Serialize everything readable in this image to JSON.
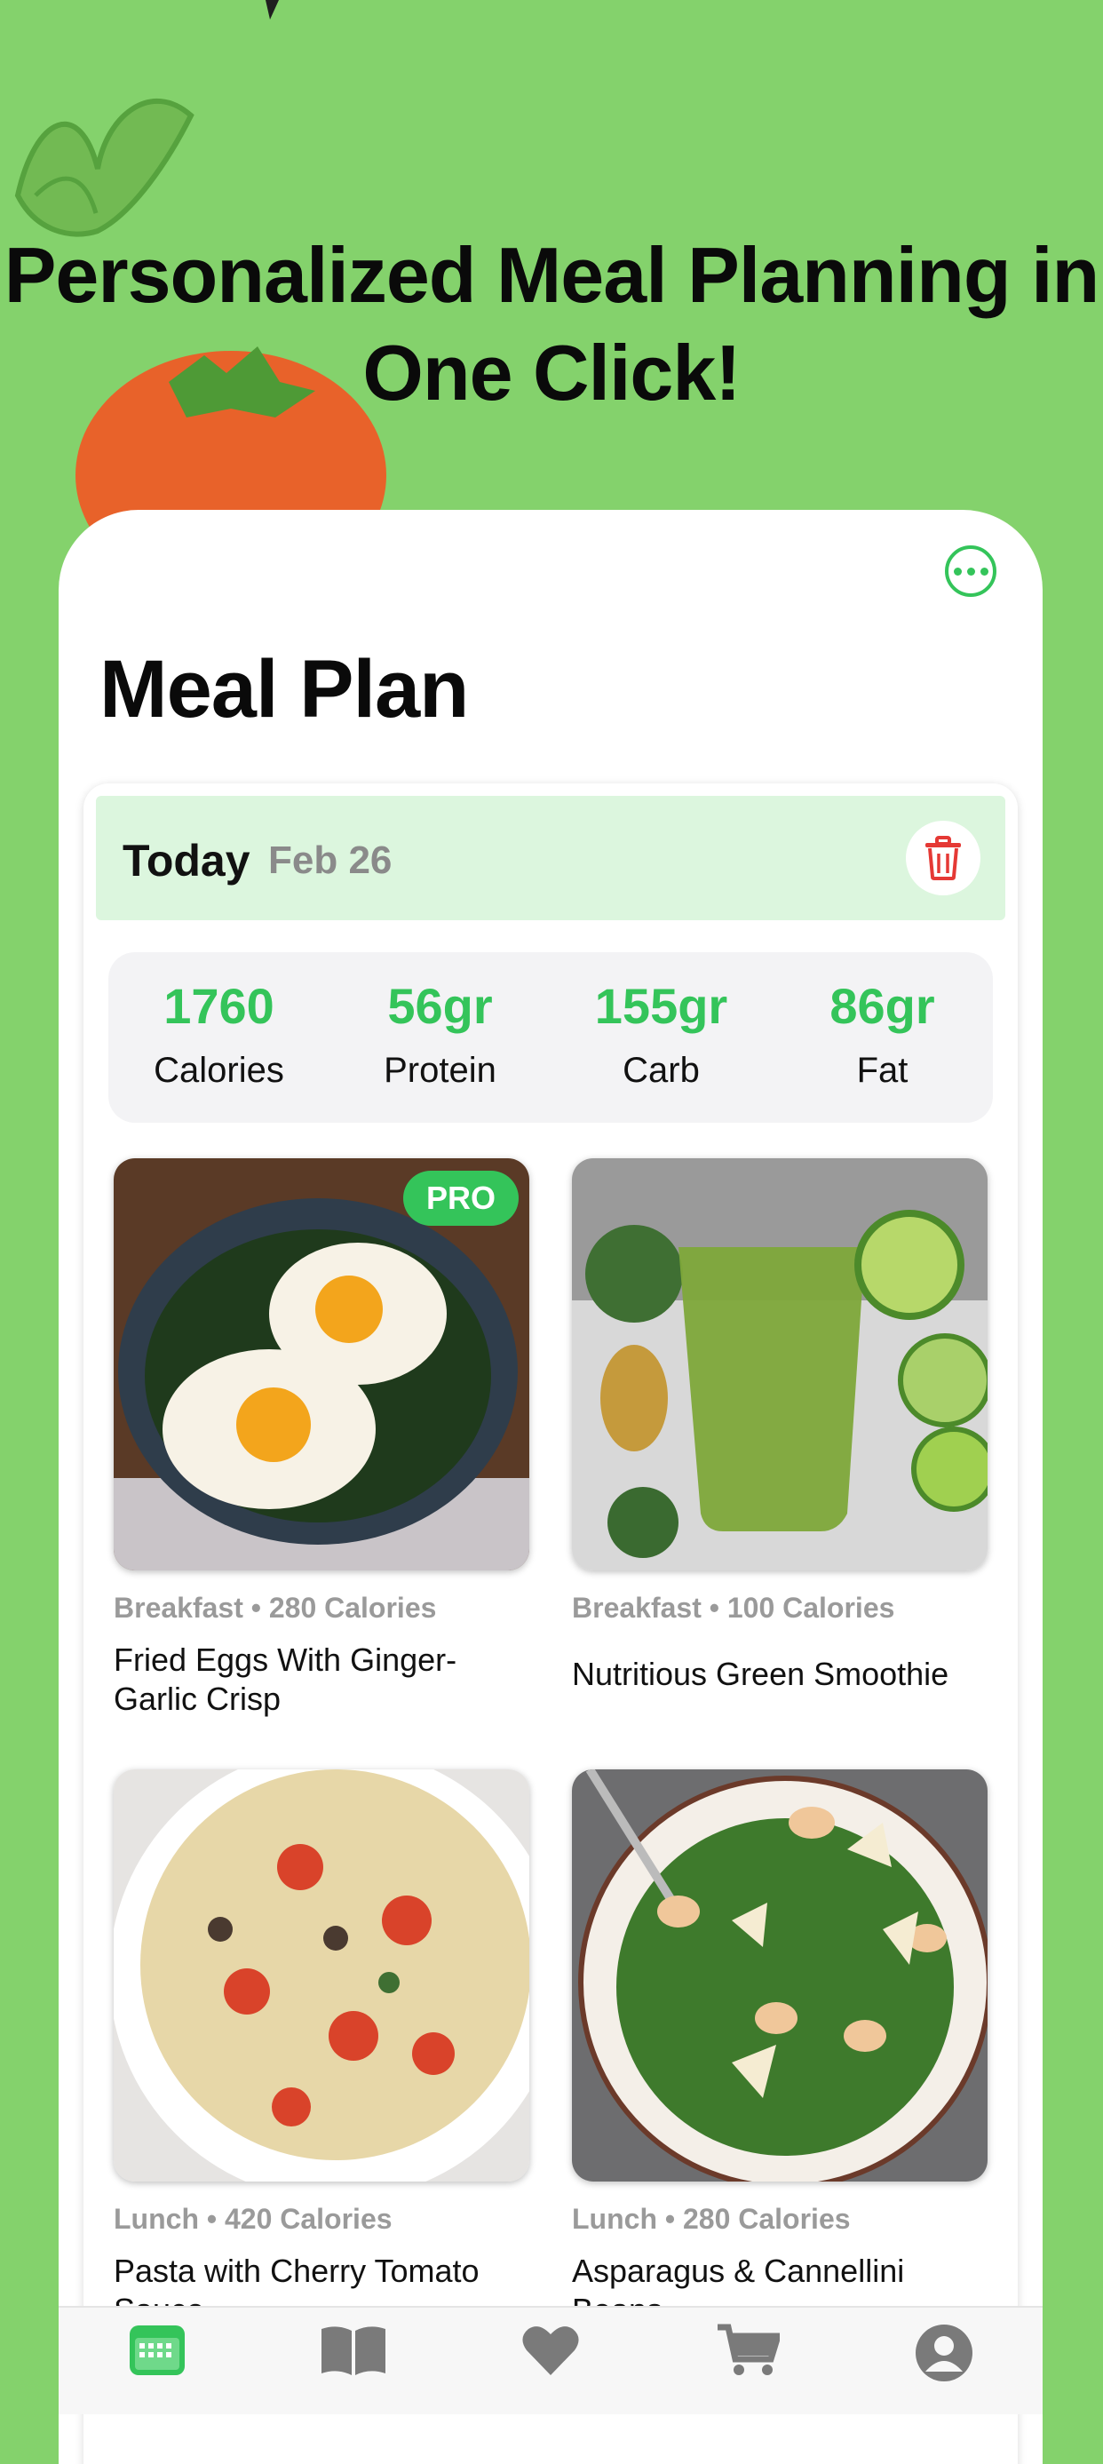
{
  "headline": "Personalized Meal Planning in One Click!",
  "screen": {
    "title": "Meal Plan",
    "day": {
      "label": "Today",
      "date": "Feb 26"
    },
    "macros": [
      {
        "value": "1760",
        "name": "Calories"
      },
      {
        "value": "56gr",
        "name": "Protein"
      },
      {
        "value": "155gr",
        "name": "Carb"
      },
      {
        "value": "86gr",
        "name": "Fat"
      }
    ],
    "meals": [
      {
        "meta": "Breakfast • 280 Calories",
        "title": "Fried Eggs With Ginger-Garlic Crisp",
        "badge": "PRO"
      },
      {
        "meta": "Breakfast • 100 Calories",
        "title": "Nutritious Green Smoothie"
      },
      {
        "meta": "Lunch • 420 Calories",
        "title": "Pasta with Cherry Tomato Sauce"
      },
      {
        "meta": "Lunch • 280 Calories",
        "title": "Asparagus & Cannellini Beans"
      }
    ]
  },
  "tabs": [
    {
      "name": "calendar-icon"
    },
    {
      "name": "book-icon"
    },
    {
      "name": "heart-icon"
    },
    {
      "name": "cart-icon"
    },
    {
      "name": "profile-icon"
    }
  ],
  "colors": {
    "background": "#84d26c",
    "accent": "#34c45a",
    "today_bar": "#dcf6de",
    "trash": "#e53935"
  }
}
